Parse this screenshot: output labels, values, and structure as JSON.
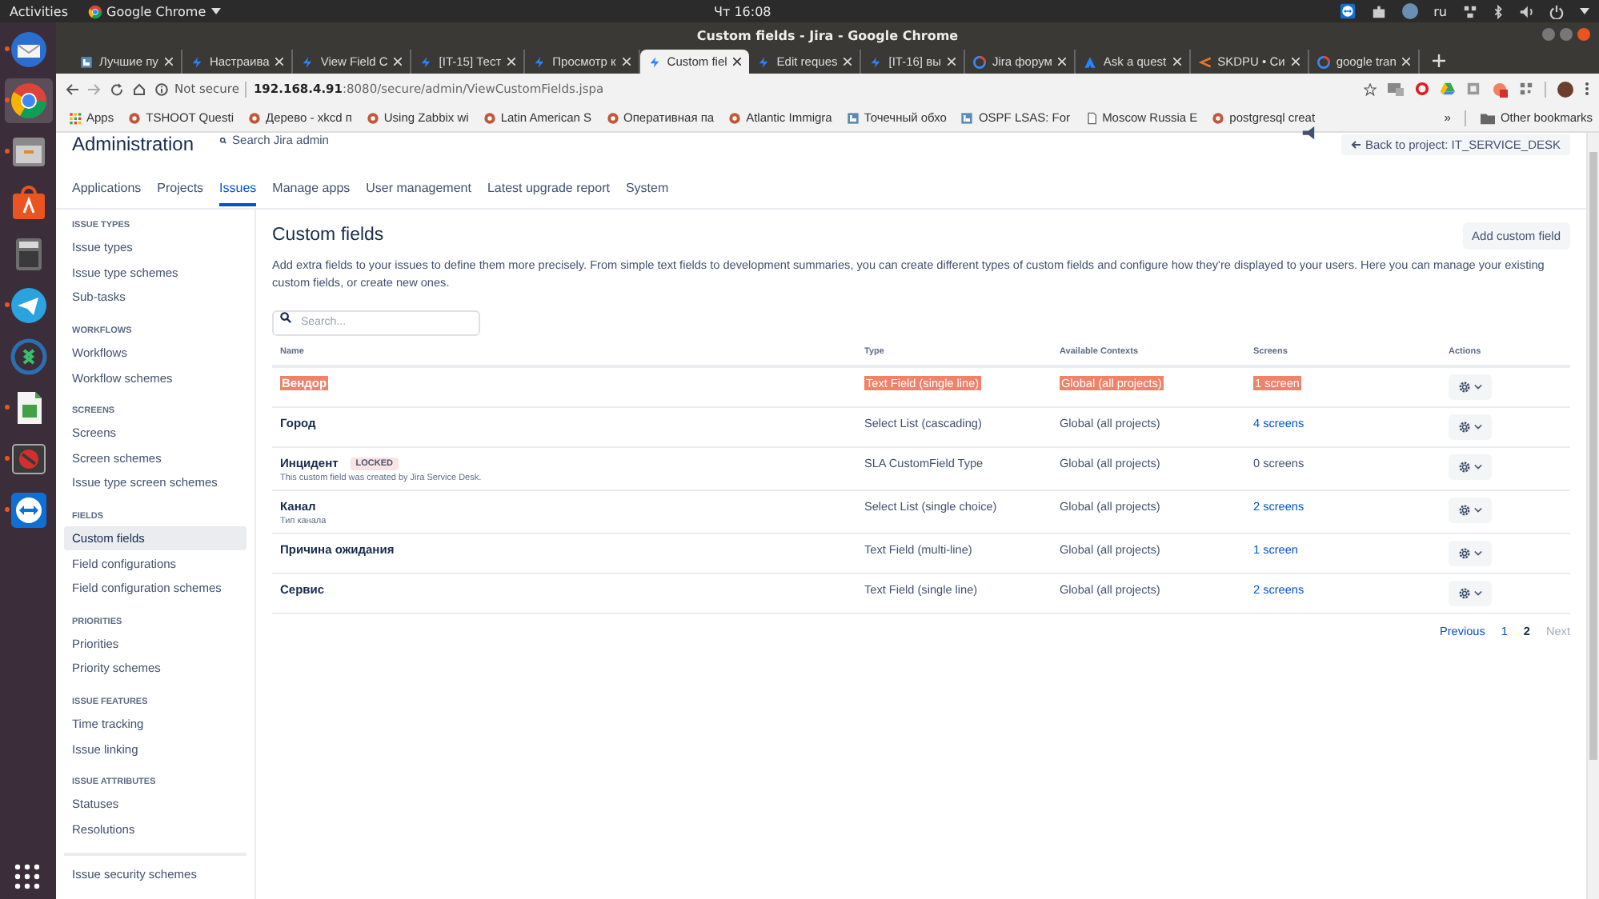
{
  "topbar": {
    "activities": "Activities",
    "app": "Google Chrome",
    "clock": "Чт 16:08",
    "language": "ru"
  },
  "dock": [
    {
      "kind": "mail",
      "running": true,
      "selected": false
    },
    {
      "kind": "browser",
      "running": true,
      "selected": true
    },
    {
      "kind": "files",
      "running": true,
      "selected": false
    },
    {
      "kind": "store",
      "running": false,
      "selected": false
    },
    {
      "kind": "calculator",
      "running": false,
      "selected": false
    },
    {
      "kind": "telegram",
      "running": true,
      "selected": false
    },
    {
      "kind": "remote",
      "running": false,
      "selected": false
    },
    {
      "kind": "spreadsheet",
      "running": true,
      "selected": false
    },
    {
      "kind": "blocked",
      "running": true,
      "selected": false
    },
    {
      "kind": "teamviewer",
      "running": true,
      "selected": false
    }
  ],
  "window": {
    "title": "Custom fields - Jira - Google Chrome"
  },
  "tabs": [
    {
      "label": "Лучшие пу",
      "kind": "letter",
      "selected": false
    },
    {
      "label": "Настраива",
      "kind": "jira",
      "selected": false
    },
    {
      "label": "View Field C",
      "kind": "jira",
      "selected": false
    },
    {
      "label": "[IT-15] Тест",
      "kind": "jira",
      "selected": false
    },
    {
      "label": "Просмотр к",
      "kind": "jira",
      "selected": false
    },
    {
      "label": "Custom fiel",
      "kind": "jira",
      "selected": true
    },
    {
      "label": "Edit reques",
      "kind": "jira",
      "selected": false
    },
    {
      "label": "[IT-16] вы",
      "kind": "jira",
      "selected": false
    },
    {
      "label": "Jira форум",
      "kind": "google",
      "selected": false
    },
    {
      "label": "Ask a quest",
      "kind": "atlassian",
      "selected": false
    },
    {
      "label": "SKDPU • Си",
      "kind": "skdpu",
      "selected": false
    },
    {
      "label": "google tran",
      "kind": "google",
      "selected": false
    }
  ],
  "address": {
    "security": "Not secure",
    "host": "192.168.4.91",
    "path": ":8080/secure/admin/ViewCustomFields.jspa"
  },
  "bookmarks": [
    {
      "label": "Apps",
      "kind": "grid"
    },
    {
      "label": "TSHOOT Questi",
      "kind": "site"
    },
    {
      "label": "Дерево - xkcd п",
      "kind": "site"
    },
    {
      "label": "Using Zabbix wi",
      "kind": "site"
    },
    {
      "label": "Latin American S",
      "kind": "site"
    },
    {
      "label": "Оперативная па",
      "kind": "site"
    },
    {
      "label": "Atlantic Immigra",
      "kind": "site"
    },
    {
      "label": "Точечный обхо",
      "kind": "letter"
    },
    {
      "label": "OSPF LSAS: For",
      "kind": "letter"
    },
    {
      "label": "Moscow Russia E",
      "kind": "page"
    },
    {
      "label": "postgresql creat",
      "kind": "site"
    }
  ],
  "bookmarks_overflow": "»",
  "other_bookmarks": "Other bookmarks",
  "header": {
    "title": "Administration",
    "search": "Search Jira admin",
    "back": "Back to project: IT_SERVICE_DESK"
  },
  "nav": [
    {
      "label": "Applications",
      "selected": false
    },
    {
      "label": "Projects",
      "selected": false
    },
    {
      "label": "Issues",
      "selected": true
    },
    {
      "label": "Manage apps",
      "selected": false
    },
    {
      "label": "User management",
      "selected": false
    },
    {
      "label": "Latest upgrade report",
      "selected": false
    },
    {
      "label": "System",
      "selected": false
    }
  ],
  "sidebar": [
    {
      "heading": "ISSUE TYPES",
      "items": [
        {
          "label": "Issue types",
          "selected": false
        },
        {
          "label": "Issue type schemes",
          "selected": false
        },
        {
          "label": "Sub-tasks",
          "selected": false
        }
      ]
    },
    {
      "heading": "WORKFLOWS",
      "items": [
        {
          "label": "Workflows",
          "selected": false
        },
        {
          "label": "Workflow schemes",
          "selected": false
        }
      ]
    },
    {
      "heading": "SCREENS",
      "items": [
        {
          "label": "Screens",
          "selected": false
        },
        {
          "label": "Screen schemes",
          "selected": false
        },
        {
          "label": "Issue type screen schemes",
          "selected": false
        }
      ]
    },
    {
      "heading": "FIELDS",
      "items": [
        {
          "label": "Custom fields",
          "selected": true
        },
        {
          "label": "Field configurations",
          "selected": false
        },
        {
          "label": "Field configuration schemes",
          "selected": false
        }
      ]
    },
    {
      "heading": "PRIORITIES",
      "items": [
        {
          "label": "Priorities",
          "selected": false
        },
        {
          "label": "Priority schemes",
          "selected": false
        }
      ]
    },
    {
      "heading": "ISSUE FEATURES",
      "items": [
        {
          "label": "Time tracking",
          "selected": false
        },
        {
          "label": "Issue linking",
          "selected": false
        }
      ]
    },
    {
      "heading": "ISSUE ATTRIBUTES",
      "items": [
        {
          "label": "Statuses",
          "selected": false
        },
        {
          "label": "Resolutions",
          "selected": false
        }
      ]
    },
    {
      "items": [
        {
          "label": "Issue security schemes",
          "selected": false
        }
      ]
    }
  ],
  "main": {
    "title": "Custom fields",
    "add_button": "Add custom field",
    "description": "Add extra fields to your issues to define them more precisely. From simple text fields to development summaries, you can create different types of custom fields and configure how they're displayed to your users. Here you can manage your existing custom fields, or create new ones.",
    "search": {
      "placeholder": "Search..."
    },
    "columns": [
      "Name",
      "Type",
      "Available Contexts",
      "Screens",
      "Actions"
    ],
    "rows": [
      {
        "name": "Вендор",
        "type": "Text Field (single line)",
        "contexts": "Global (all projects)",
        "screens": "1 screen",
        "screens_linked": true,
        "highlighted": true
      },
      {
        "name": "Город",
        "type": "Select List (cascading)",
        "contexts": "Global (all projects)",
        "screens": "4 screens",
        "screens_linked": true,
        "highlighted": false
      },
      {
        "name": "Инцидент",
        "badge": "LOCKED",
        "description": "This custom field was created by Jira Service Desk.",
        "type": "SLA CustomField Type",
        "contexts": "Global (all projects)",
        "screens": "0 screens",
        "screens_linked": false,
        "highlighted": false
      },
      {
        "name": "Канал",
        "description": "Тип канала",
        "type": "Select List (single choice)",
        "contexts": "Global (all projects)",
        "screens": "2 screens",
        "screens_linked": true,
        "highlighted": false
      },
      {
        "name": "Причина ожидания",
        "type": "Text Field (multi-line)",
        "contexts": "Global (all projects)",
        "screens": "1 screen",
        "screens_linked": true,
        "highlighted": false
      },
      {
        "name": "Сервис",
        "type": "Text Field (single line)",
        "contexts": "Global (all projects)",
        "screens": "2 screens",
        "screens_linked": true,
        "highlighted": false
      }
    ],
    "pagination": {
      "previous": "Previous",
      "pages": [
        {
          "label": "1",
          "selected": false
        },
        {
          "label": "2",
          "selected": true
        }
      ],
      "next": "Next",
      "next_disabled": true
    }
  }
}
